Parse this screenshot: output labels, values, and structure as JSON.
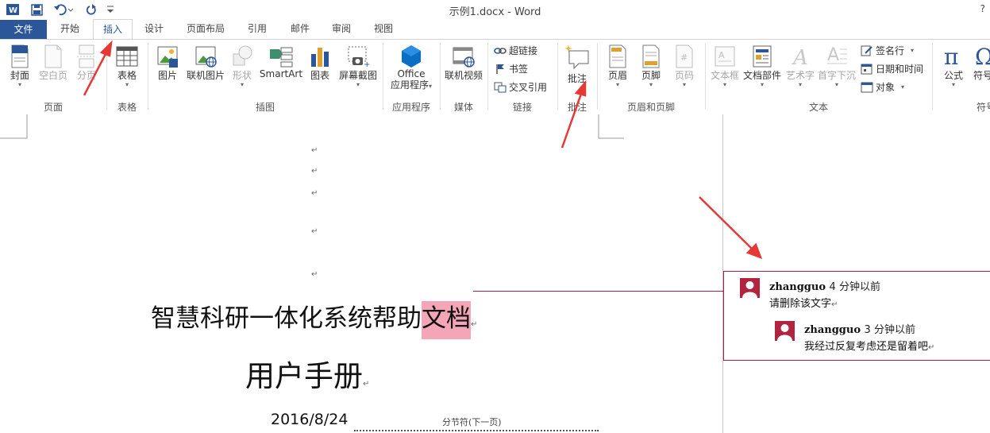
{
  "window": {
    "title": "示例1.docx - Word",
    "help": "?"
  },
  "tabs": [
    "文件",
    "开始",
    "插入",
    "设计",
    "页面布局",
    "引用",
    "邮件",
    "审阅",
    "视图"
  ],
  "ribbon": {
    "pages": {
      "cover": "封面",
      "blank": "空白页",
      "break": "分页",
      "group": "页面"
    },
    "table": {
      "table": "表格",
      "group": "表格"
    },
    "illustrations": {
      "picture": "图片",
      "online_picture": "联机图片",
      "shapes": "形状",
      "smartart": "SmartArt",
      "chart": "图表",
      "screenshot": "屏幕截图",
      "group": "插图"
    },
    "apps": {
      "office_line1": "Office",
      "office_line2": "应用程序",
      "group": "应用程序"
    },
    "media": {
      "online_video": "联机视频",
      "group": "媒体"
    },
    "links": {
      "hyperlink": "超链接",
      "bookmark": "书签",
      "crossref": "交叉引用",
      "group": "链接"
    },
    "comments": {
      "comment": "批注",
      "group": "批注"
    },
    "header_footer": {
      "header": "页眉",
      "footer": "页脚",
      "page_number": "页码",
      "group": "页眉和页脚"
    },
    "text": {
      "textbox": "文本框",
      "quickparts": "文档部件",
      "wordart": "艺术字",
      "dropcap": "首字下沉",
      "signature": "签名行",
      "datetime": "日期和时间",
      "object": "对象",
      "group": "文本"
    },
    "symbols": {
      "equation": "公式",
      "symbol": "符号",
      "group": "符号"
    }
  },
  "document": {
    "para_mark": "↵",
    "title_plain": "智慧科研一体化系统帮助",
    "title_highlight": "文档",
    "subtitle": "用户手册",
    "date": "2016/8/24",
    "section_break": "分节符(下一页)"
  },
  "comments": [
    {
      "author": "zhangguo",
      "time": "4 分钟以前",
      "text": "请删除该文字"
    },
    {
      "author": "zhangguo",
      "time": "3 分钟以前",
      "text": "我经过反复考虑还是留着吧"
    }
  ],
  "colors": {
    "accent": "#2b579a",
    "comment": "#a3204b",
    "highlight": "#f4a5b7",
    "arrow": "#e53935"
  }
}
